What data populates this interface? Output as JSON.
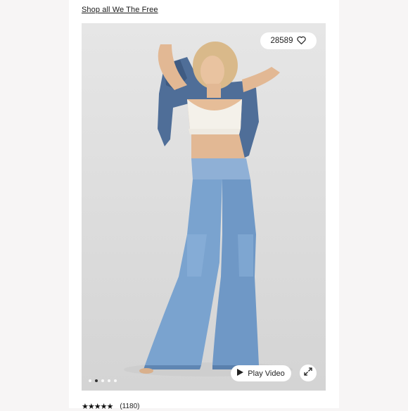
{
  "header": {
    "shop_link": "Shop all We The Free"
  },
  "gallery": {
    "like_count": "28589",
    "play_video_label": "Play Video",
    "dot_count": 5,
    "active_dot": 1
  },
  "reviews": {
    "stars": "★★★★★",
    "count": "(1180)"
  },
  "colors": {
    "page_bg": "#f7f5f5",
    "card_bg": "#ffffff",
    "denim": "#7aa3cf"
  },
  "icons": [
    "heart-icon",
    "play-icon",
    "expand-icon"
  ]
}
